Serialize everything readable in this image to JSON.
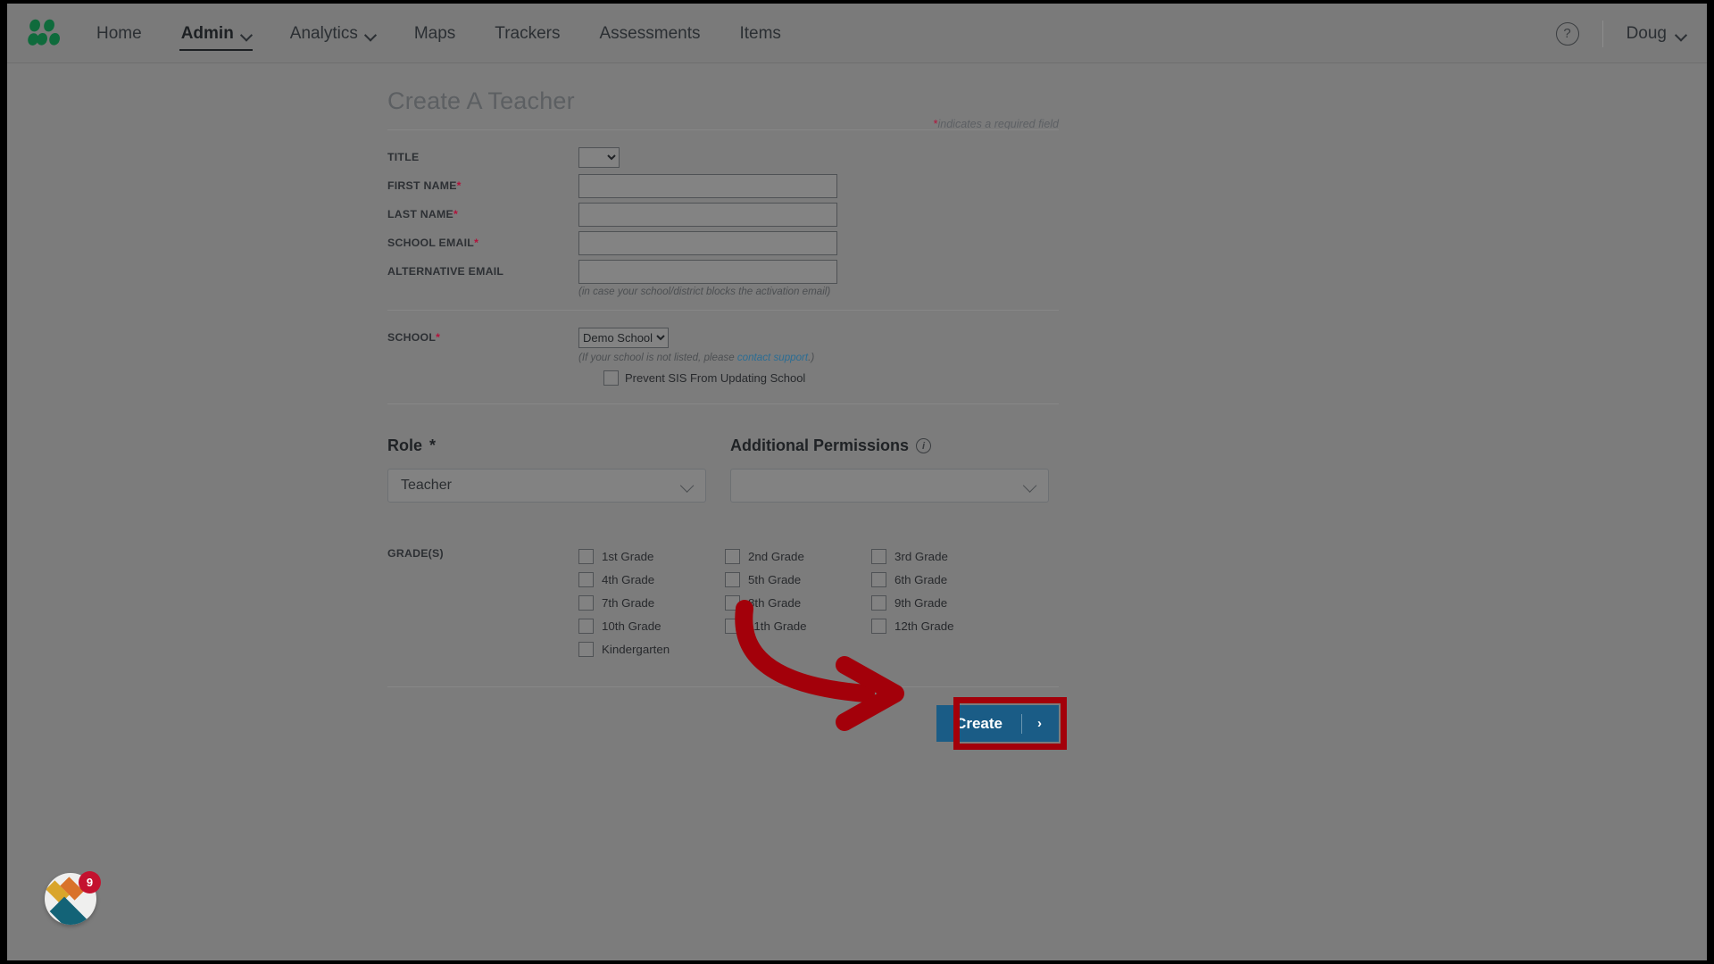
{
  "nav": {
    "logo_icon": "dots-leaf-logo",
    "items": [
      {
        "label": "Home",
        "has_caret": false,
        "active": false
      },
      {
        "label": "Admin",
        "has_caret": true,
        "active": true
      },
      {
        "label": "Analytics",
        "has_caret": true,
        "active": false
      },
      {
        "label": "Maps",
        "has_caret": false,
        "active": false
      },
      {
        "label": "Trackers",
        "has_caret": false,
        "active": false
      },
      {
        "label": "Assessments",
        "has_caret": false,
        "active": false
      },
      {
        "label": "Items",
        "has_caret": false,
        "active": false
      }
    ],
    "help_icon": "question-mark-icon",
    "help_glyph": "?",
    "user_label": "Doug"
  },
  "page": {
    "title": "Create A Teacher",
    "required_note_star": "*",
    "required_note": "indicates a required field"
  },
  "form": {
    "title_label": "TITLE",
    "title_value": "",
    "first_name_label": "FIRST NAME",
    "first_name_value": "",
    "last_name_label": "LAST NAME",
    "last_name_value": "",
    "school_email_label": "SCHOOL EMAIL",
    "school_email_value": "",
    "alternative_email_label": "ALTERNATIVE EMAIL",
    "alternative_email_value": "",
    "alternative_email_hint": "(in case your school/district blocks the activation email)",
    "school_label": "SCHOOL",
    "school_value": "Demo School",
    "school_hint_pre": "(If your school is not listed, please ",
    "school_hint_link": "contact support",
    "school_hint_post": ".)",
    "prevent_sis_label": "Prevent SIS From Updating School",
    "prevent_sis_checked": false,
    "required_marker": "*"
  },
  "role": {
    "heading": "Role",
    "heading_marker": "*",
    "value": "Teacher"
  },
  "permissions": {
    "heading": "Additional Permissions",
    "info_icon": "info-icon",
    "info_glyph": "i",
    "value": ""
  },
  "grades": {
    "label": "GRADE(S)",
    "columns": [
      [
        {
          "label": "1st Grade",
          "checked": false
        },
        {
          "label": "4th Grade",
          "checked": false
        },
        {
          "label": "7th Grade",
          "checked": false
        },
        {
          "label": "10th Grade",
          "checked": false
        },
        {
          "label": "Kindergarten",
          "checked": false
        }
      ],
      [
        {
          "label": "2nd Grade",
          "checked": false
        },
        {
          "label": "5th Grade",
          "checked": false
        },
        {
          "label": "8th Grade",
          "checked": false
        },
        {
          "label": "11th Grade",
          "checked": false
        }
      ],
      [
        {
          "label": "3rd Grade",
          "checked": false
        },
        {
          "label": "6th Grade",
          "checked": false
        },
        {
          "label": "9th Grade",
          "checked": false
        },
        {
          "label": "12th Grade",
          "checked": false
        }
      ]
    ]
  },
  "submit": {
    "label": "Create",
    "arrow_glyph": "›"
  },
  "annotation": {
    "arrow_color": "#a3000a",
    "highlight_color": "#a3000a",
    "type": "curved-arrow-pointing-to-create-button"
  },
  "launcher": {
    "name": "guide-launcher",
    "badge_count": "9",
    "badge_color": "#c4122f"
  },
  "colors": {
    "nav_background": "#7a7a7a",
    "page_background": "#7c7c7c",
    "primary_button": "#1a5c86",
    "required_star": "#b3123b",
    "link": "#2b6d94",
    "logo_green": "#0f6b3c"
  }
}
